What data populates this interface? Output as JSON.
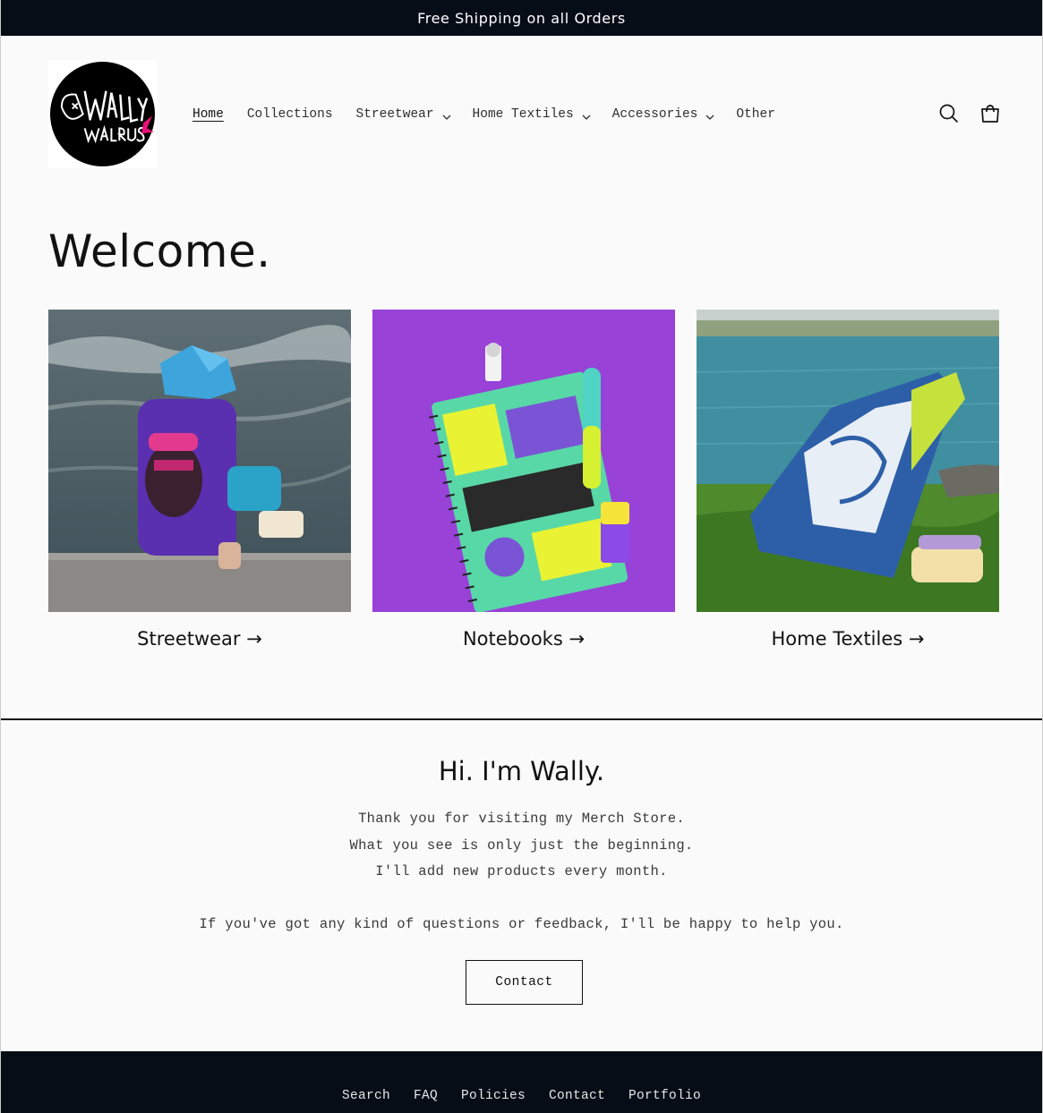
{
  "announcement": {
    "text": "Free Shipping on all Orders"
  },
  "header": {
    "logo_alt": "Wally Walrus",
    "nav": [
      {
        "label": "Home",
        "active": true,
        "dropdown": false
      },
      {
        "label": "Collections",
        "active": false,
        "dropdown": false
      },
      {
        "label": "Streetwear",
        "active": false,
        "dropdown": true
      },
      {
        "label": "Home Textiles",
        "active": false,
        "dropdown": true
      },
      {
        "label": "Accessories",
        "active": false,
        "dropdown": true
      },
      {
        "label": "Other",
        "active": false,
        "dropdown": false
      }
    ],
    "icons": [
      "search-icon",
      "cart-icon"
    ]
  },
  "main": {
    "heading": "Welcome.",
    "cards": [
      {
        "label": "Streetwear →"
      },
      {
        "label": "Notebooks →"
      },
      {
        "label": "Home Textiles →"
      }
    ]
  },
  "about": {
    "heading": "Hi. I'm Wally.",
    "lines": [
      "Thank you for visiting my Merch Store.",
      "What you see is only just the beginning.",
      "I'll add new products every month."
    ],
    "line_extra": "If you've got any kind of questions or feedback, I'll be happy to help you.",
    "button_label": "Contact"
  },
  "footer": {
    "links": [
      "Search",
      "FAQ",
      "Policies",
      "Contact",
      "Portfolio"
    ]
  },
  "colors": {
    "dark_bar": "#060d17",
    "background": "#fafafa",
    "text": "#121212",
    "logo_accent": "#e8127a"
  }
}
